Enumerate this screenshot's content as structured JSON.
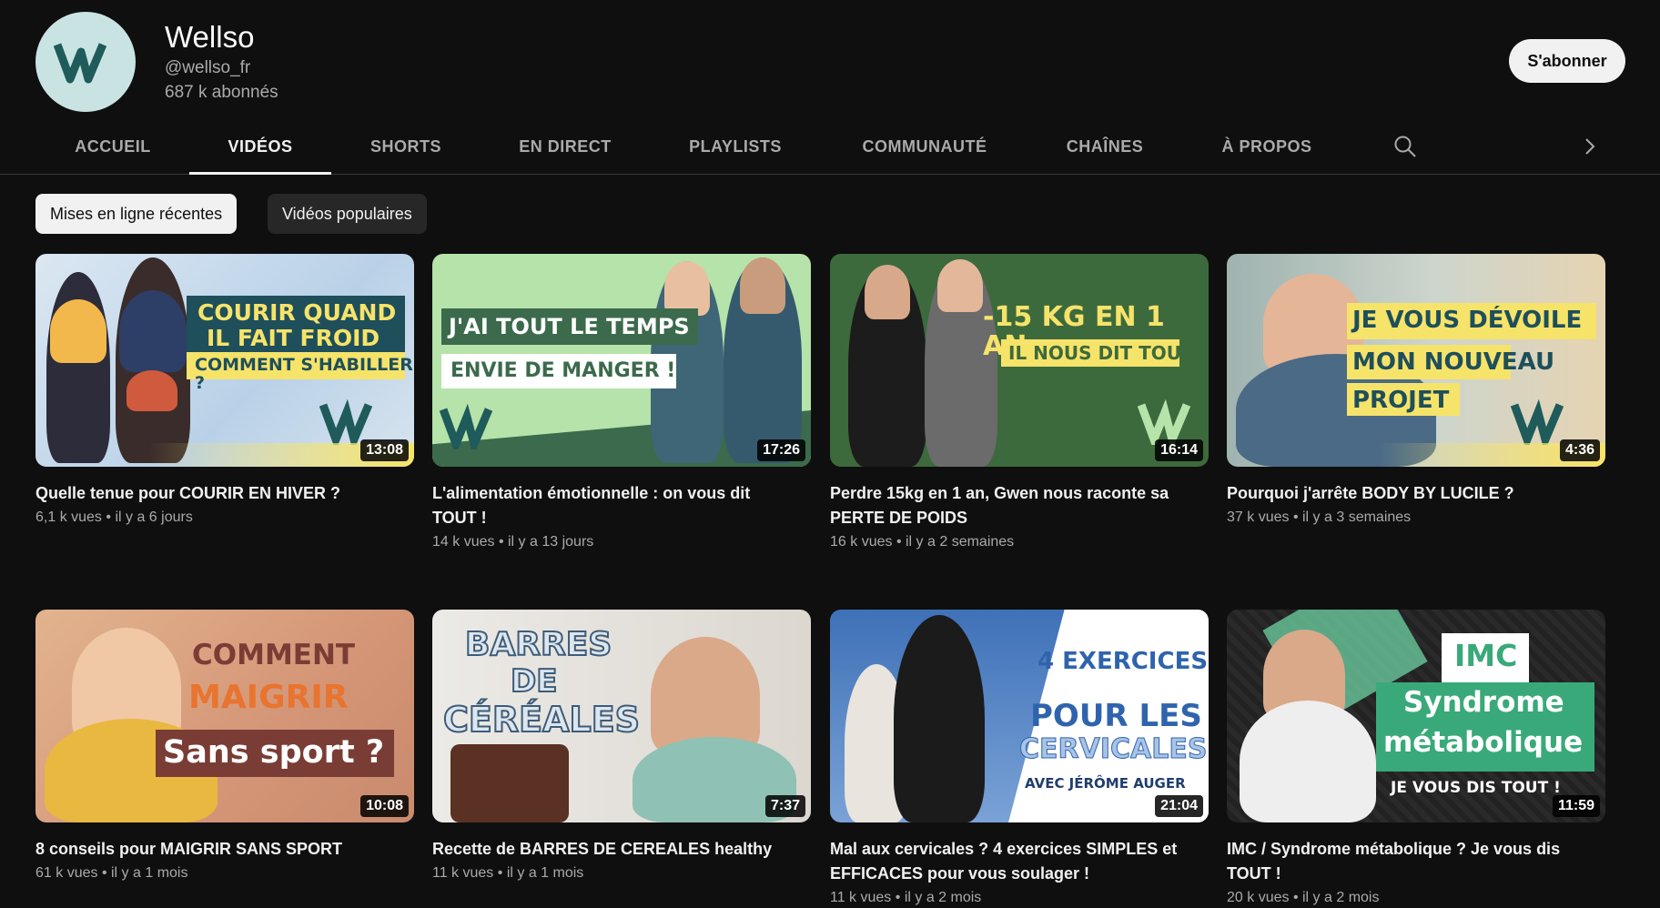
{
  "channel": {
    "name": "Wellso",
    "handle": "@wellso_fr",
    "subscribers": "687 k abonnés",
    "subscribe_label": "S'abonner",
    "avatar_letter": "W",
    "brand_color": "#1f5b5a"
  },
  "tabs": [
    {
      "label": "ACCUEIL",
      "active": false
    },
    {
      "label": "VIDÉOS",
      "active": true
    },
    {
      "label": "SHORTS",
      "active": false
    },
    {
      "label": "EN DIRECT",
      "active": false
    },
    {
      "label": "PLAYLISTS",
      "active": false
    },
    {
      "label": "COMMUNAUTÉ",
      "active": false
    },
    {
      "label": "CHAÎNES",
      "active": false
    },
    {
      "label": "À PROPOS",
      "active": false
    }
  ],
  "filters": {
    "recent_label": "Mises en ligne récentes",
    "popular_label": "Vidéos populaires"
  },
  "videos": [
    {
      "title": "Quelle tenue pour COURIR EN HIVER ?",
      "views": "6,1 k vues",
      "age": "il y a 6 jours",
      "duration": "13:08",
      "thumb_lines": [
        "COURIR QUAND",
        "IL FAIT FROID",
        "COMMENT S'HABILLER ?"
      ]
    },
    {
      "title": "L'alimentation émotionnelle : on vous dit TOUT !",
      "views": "14 k vues",
      "age": "il y a 13 jours",
      "duration": "17:26",
      "thumb_lines": [
        "J'AI TOUT LE TEMPS",
        "ENVIE DE MANGER !"
      ]
    },
    {
      "title": "Perdre 15kg en 1 an, Gwen nous raconte sa PERTE DE POIDS",
      "views": "16 k vues",
      "age": "il y a 2 semaines",
      "duration": "16:14",
      "thumb_lines": [
        "-15 KG EN 1 AN",
        "IL NOUS DIT TOUT"
      ]
    },
    {
      "title": "Pourquoi j'arrête BODY BY LUCILE ?",
      "views": "37 k vues",
      "age": "il y a 3 semaines",
      "duration": "4:36",
      "thumb_lines": [
        "JE VOUS DÉVOILE",
        "MON NOUVEAU",
        "PROJET"
      ]
    },
    {
      "title": "8 conseils pour MAIGRIR SANS SPORT",
      "views": "61 k vues",
      "age": "il y a 1 mois",
      "duration": "10:08",
      "thumb_lines": [
        "COMMENT",
        "MAIGRIR",
        "Sans sport ?"
      ]
    },
    {
      "title": "Recette de BARRES DE CEREALES healthy",
      "views": "11 k vues",
      "age": "il y a 1 mois",
      "duration": "7:37",
      "thumb_lines": [
        "BARRES",
        "DE",
        "CÉRÉALES"
      ]
    },
    {
      "title": "Mal aux cervicales ? 4 exercices SIMPLES et EFFICACES pour vous soulager !",
      "views": "11 k vues",
      "age": "il y a 2 mois",
      "duration": "21:04",
      "thumb_lines": [
        "4 EXERCICES",
        "POUR LES",
        "CERVICALES",
        "AVEC JÉRÔME AUGER"
      ]
    },
    {
      "title": "IMC / Syndrome métabolique ? Je vous dis TOUT !",
      "views": "20 k vues",
      "age": "il y a 2 mois",
      "duration": "11:59",
      "thumb_lines": [
        "IMC",
        "Syndrome",
        "métabolique",
        "JE VOUS DIS TOUT !"
      ]
    }
  ],
  "meta_separator": "•"
}
